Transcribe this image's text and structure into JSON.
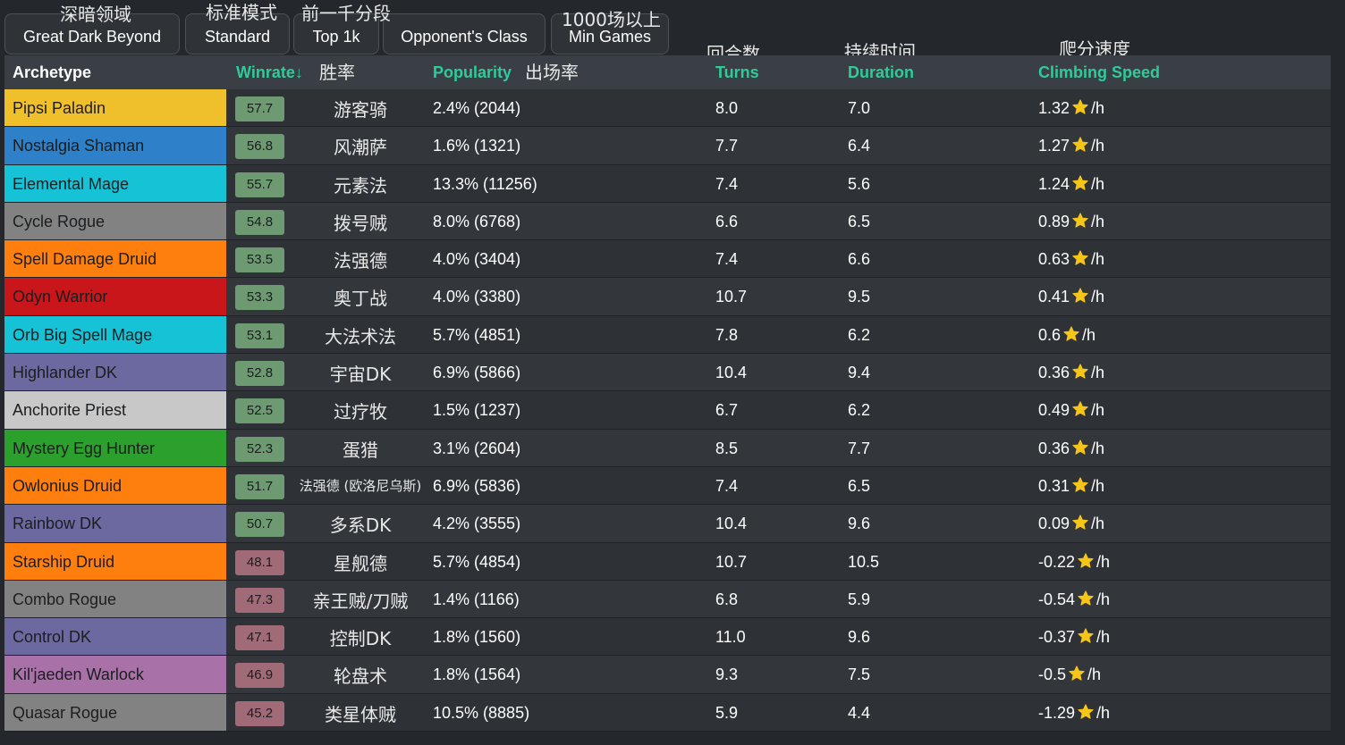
{
  "filters": [
    {
      "label": "Great Dark Beyond",
      "caption_cn": "深暗领域"
    },
    {
      "label": "Standard",
      "caption_cn": "标准模式"
    },
    {
      "label": "Top 1k",
      "caption_cn": "前一千分段"
    },
    {
      "label": "Opponent's Class",
      "caption_cn": ""
    },
    {
      "label": "Min Games",
      "caption_cn": "1000场以上"
    }
  ],
  "header": {
    "archetype": "Archetype",
    "winrate": "Winrate↓",
    "winrate_cn": "胜率",
    "popularity": "Popularity",
    "popularity_cn": "出场率",
    "turns": "Turns",
    "turns_cn": "回合数",
    "duration": "Duration",
    "duration_cn": "持续时间",
    "climbing": "Climbing Speed",
    "climbing_cn": "爬分速度"
  },
  "colors": {
    "accent_green": "#2ecc9a",
    "winrate_positive": "#6e9a72",
    "winrate_negative": "#a06b76",
    "star": "#f5c518"
  },
  "per_hour_suffix": "/h",
  "rows": [
    {
      "archetype": "Pipsi Paladin",
      "class_color": "#f0c02c",
      "winrate": "57.7",
      "cn": "游客骑",
      "popularity": "2.4% (2044)",
      "turns": "8.0",
      "duration": "7.0",
      "climbing": "1.32"
    },
    {
      "archetype": "Nostalgia Shaman",
      "class_color": "#2e80c8",
      "winrate": "56.8",
      "cn": "风潮萨",
      "popularity": "1.6% (1321)",
      "turns": "7.7",
      "duration": "6.4",
      "climbing": "1.27"
    },
    {
      "archetype": "Elemental Mage",
      "class_color": "#16c3d6",
      "winrate": "55.7",
      "cn": "元素法",
      "popularity": "13.3% (11256)",
      "turns": "7.4",
      "duration": "5.6",
      "climbing": "1.24"
    },
    {
      "archetype": "Cycle Rogue",
      "class_color": "#828282",
      "winrate": "54.8",
      "cn": "拨号贼",
      "popularity": "8.0% (6768)",
      "turns": "6.6",
      "duration": "6.5",
      "climbing": "0.89"
    },
    {
      "archetype": "Spell Damage Druid",
      "class_color": "#ff7f0e",
      "winrate": "53.5",
      "cn": "法强德",
      "popularity": "4.0% (3404)",
      "turns": "7.4",
      "duration": "6.6",
      "climbing": "0.63"
    },
    {
      "archetype": "Odyn Warrior",
      "class_color": "#c8161b",
      "winrate": "53.3",
      "cn": "奥丁战",
      "popularity": "4.0% (3380)",
      "turns": "10.7",
      "duration": "9.5",
      "climbing": "0.41"
    },
    {
      "archetype": "Orb Big Spell Mage",
      "class_color": "#16c3d6",
      "winrate": "53.1",
      "cn": "大法术法",
      "popularity": "5.7% (4851)",
      "turns": "7.8",
      "duration": "6.2",
      "climbing": "0.6"
    },
    {
      "archetype": "Highlander DK",
      "class_color": "#6c69a0",
      "winrate": "52.8",
      "cn": "宇宙DK",
      "popularity": "6.9% (5866)",
      "turns": "10.4",
      "duration": "9.4",
      "climbing": "0.36"
    },
    {
      "archetype": "Anchorite Priest",
      "class_color": "#c8c8c8",
      "winrate": "52.5",
      "cn": "过疗牧",
      "popularity": "1.5% (1237)",
      "turns": "6.7",
      "duration": "6.2",
      "climbing": "0.49"
    },
    {
      "archetype": "Mystery Egg Hunter",
      "class_color": "#2ca02c",
      "winrate": "52.3",
      "cn": "蛋猎",
      "popularity": "3.1% (2604)",
      "turns": "8.5",
      "duration": "7.7",
      "climbing": "0.36"
    },
    {
      "archetype": "Owlonius Druid",
      "class_color": "#ff7f0e",
      "winrate": "51.7",
      "cn": "法强德 (欧洛尼乌斯)",
      "popularity": "6.9% (5836)",
      "turns": "7.4",
      "duration": "6.5",
      "climbing": "0.31"
    },
    {
      "archetype": "Rainbow DK",
      "class_color": "#6c69a0",
      "winrate": "50.7",
      "cn": "多系DK",
      "popularity": "4.2% (3555)",
      "turns": "10.4",
      "duration": "9.6",
      "climbing": "0.09"
    },
    {
      "archetype": "Starship Druid",
      "class_color": "#ff7f0e",
      "winrate": "48.1",
      "cn": "星舰德",
      "popularity": "5.7% (4854)",
      "turns": "10.7",
      "duration": "10.5",
      "climbing": "-0.22"
    },
    {
      "archetype": "Combo Rogue",
      "class_color": "#828282",
      "winrate": "47.3",
      "cn": "亲王贼/刀贼",
      "popularity": "1.4% (1166)",
      "turns": "6.8",
      "duration": "5.9",
      "climbing": "-0.54"
    },
    {
      "archetype": "Control DK",
      "class_color": "#6c69a0",
      "winrate": "47.1",
      "cn": "控制DK",
      "popularity": "1.8% (1560)",
      "turns": "11.0",
      "duration": "9.6",
      "climbing": "-0.37"
    },
    {
      "archetype": "Kil'jaeden Warlock",
      "class_color": "#a872a8",
      "winrate": "46.9",
      "cn": "轮盘术",
      "popularity": "1.8% (1564)",
      "turns": "9.3",
      "duration": "7.5",
      "climbing": "-0.5"
    },
    {
      "archetype": "Quasar Rogue",
      "class_color": "#828282",
      "winrate": "45.2",
      "cn": "类星体贼",
      "popularity": "10.5% (8885)",
      "turns": "5.9",
      "duration": "4.4",
      "climbing": "-1.29"
    }
  ]
}
